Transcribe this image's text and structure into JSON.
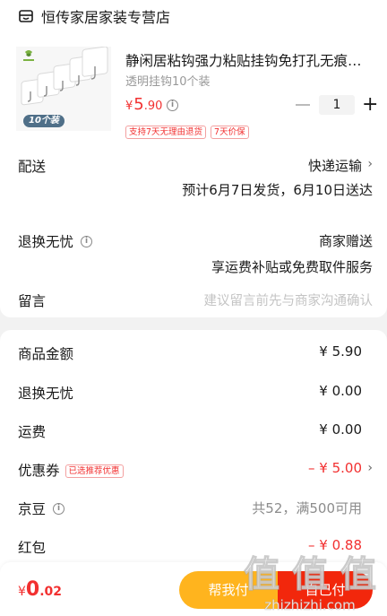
{
  "shop": {
    "name": "恒传家居家装专营店",
    "icon": "store-icon"
  },
  "product": {
    "title": "静闲居粘钩强力粘贴挂钩免打孔无痕…",
    "spec": "透明挂钩10个装",
    "price_currency": "¥",
    "price_int": "5",
    "price_dec": ".90",
    "quantity": "1",
    "image_badge": "10个装",
    "tags": [
      "支持7天无理由退货",
      "7天价保"
    ]
  },
  "delivery": {
    "label": "配送",
    "method": "快递运输",
    "estimate": "预计6月7日发货，6月10日送达"
  },
  "returns": {
    "label": "退换无忧",
    "value": "商家赠送",
    "note": "享运费补贴或免费取件服务"
  },
  "message": {
    "label": "留言",
    "placeholder": "建议留言前先与商家沟通确认"
  },
  "summary": {
    "goods_label": "商品金额",
    "goods_value": "¥ 5.90",
    "returns_label": "退换无忧",
    "returns_value": "¥ 0.00",
    "shipping_label": "运费",
    "shipping_value": "¥ 0.00",
    "coupon_label": "优惠券",
    "coupon_tag": "已选推荐优惠",
    "coupon_value": "– ¥ 5.00",
    "beans_label": "京豆",
    "beans_value": "共52，满500可用",
    "redpacket_label": "红包",
    "redpacket_value": "– ¥ 0.88"
  },
  "footer": {
    "total_currency": "¥",
    "total_int": "0",
    "total_dec": ".02",
    "help_pay_label": "帮我付",
    "self_pay_label": "自己付"
  },
  "watermark": {
    "text": "值 值 值",
    "site": "zhizhizhi.com"
  },
  "colors": {
    "accent_red": "#f23030",
    "pay_red": "#f2270c",
    "help_orange": "#ffb41e",
    "placeholder_gray": "#c4c4c4"
  }
}
